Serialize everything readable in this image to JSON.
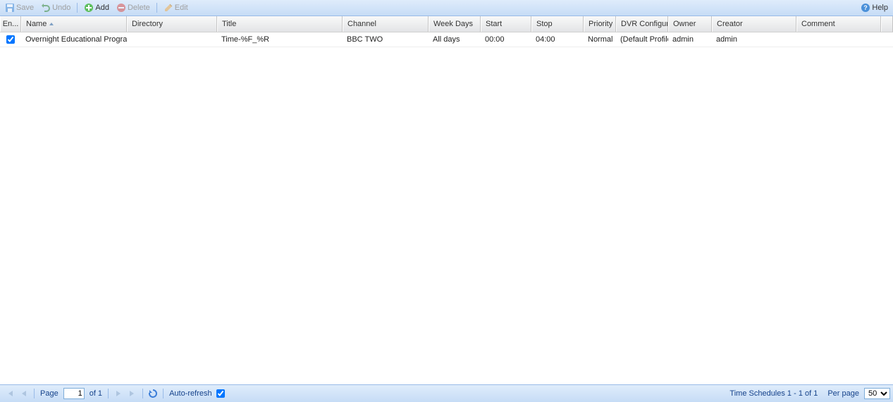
{
  "toolbar": {
    "save": "Save",
    "undo": "Undo",
    "add": "Add",
    "delete": "Delete",
    "edit": "Edit",
    "help": "Help"
  },
  "columns": {
    "enabled": "En...",
    "name": "Name",
    "directory": "Directory",
    "title": "Title",
    "channel": "Channel",
    "weekdays": "Week Days",
    "start": "Start",
    "stop": "Stop",
    "priority": "Priority",
    "dvrconfig": "DVR Configura...",
    "owner": "Owner",
    "creator": "Creator",
    "comment": "Comment"
  },
  "rows": [
    {
      "enabled": true,
      "name": "Overnight Educational Programmes",
      "directory": "",
      "title": "Time-%F_%R",
      "channel": "BBC TWO",
      "weekdays": "All days",
      "start": "00:00",
      "stop": "04:00",
      "priority": "Normal",
      "dvrconfig": "(Default Profile)",
      "owner": "admin",
      "creator": "admin",
      "comment": ""
    }
  ],
  "footer": {
    "page_label": "Page",
    "page_value": "1",
    "page_total": "of 1",
    "autorefresh": "Auto-refresh",
    "status": "Time Schedules 1 - 1 of 1",
    "perpage_label": "Per page",
    "perpage_value": "50"
  }
}
